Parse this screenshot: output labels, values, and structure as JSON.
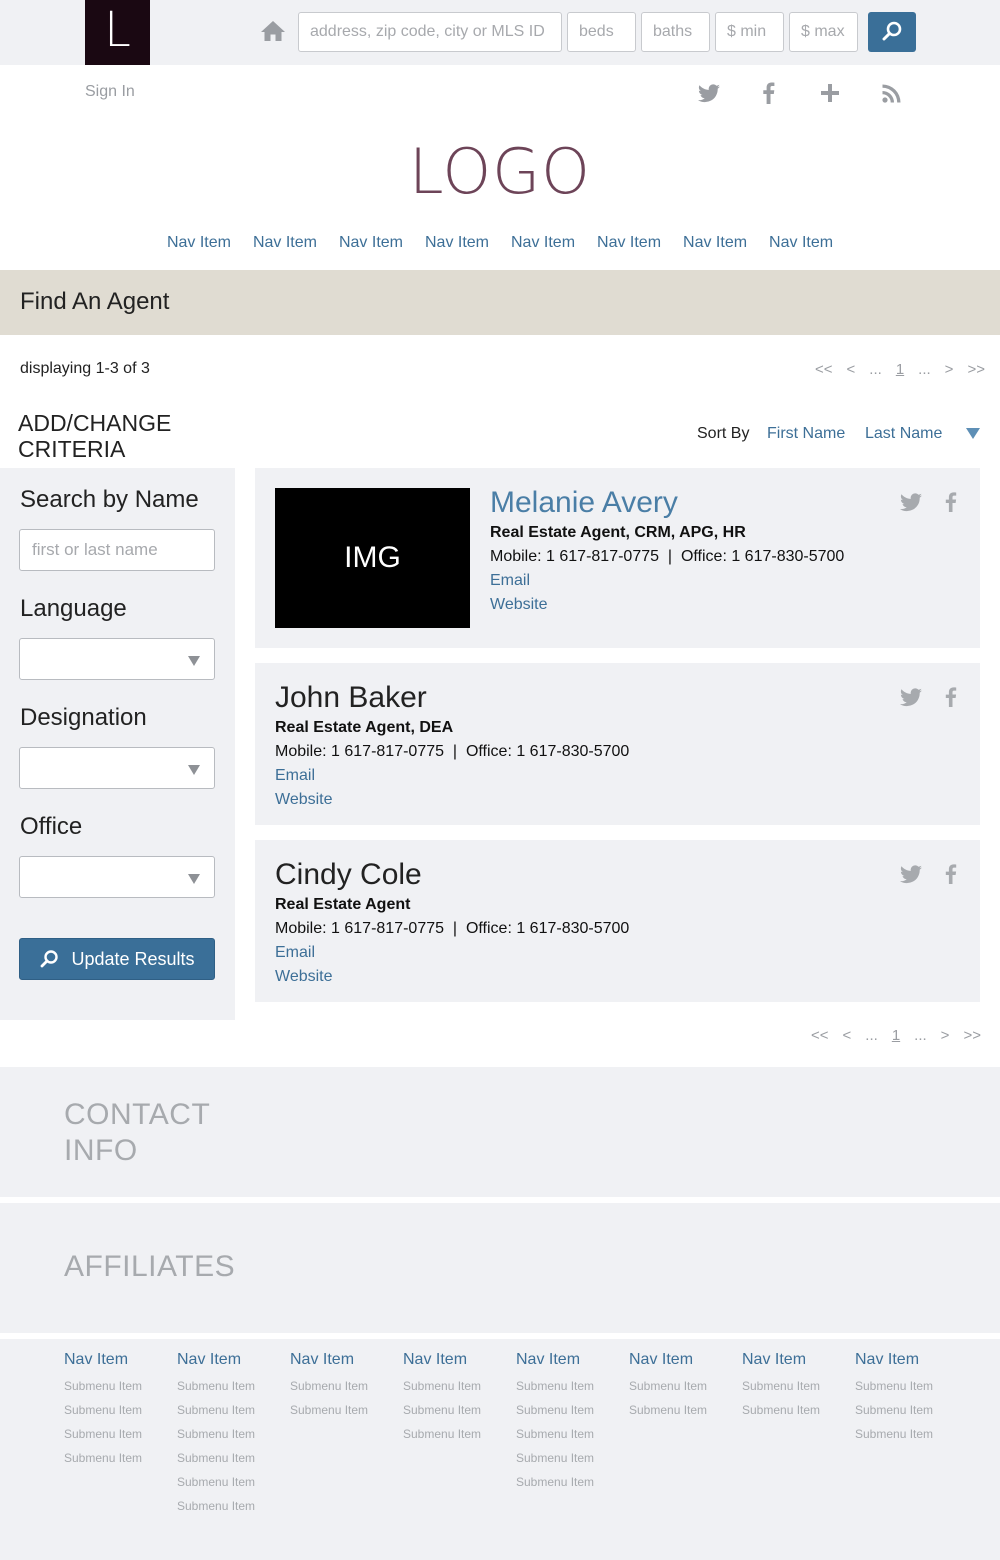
{
  "brand_mark": "L",
  "search": {
    "address_placeholder": "address, zip code, city or MLS ID",
    "beds_placeholder": "beds",
    "baths_placeholder": "baths",
    "min_placeholder": "$ min",
    "max_placeholder": "$ max"
  },
  "header": {
    "sign_in": "Sign In",
    "logo": "LOGO",
    "nav": [
      "Nav Item",
      "Nav Item",
      "Nav Item",
      "Nav Item",
      "Nav Item",
      "Nav Item",
      "Nav Item",
      "Nav Item"
    ]
  },
  "page": {
    "title": "Find An Agent",
    "displaying": "displaying 1-3 of 3",
    "criteria_title": "ADD/CHANGE CRITERIA",
    "sort_by_label": "Sort By",
    "sort_first": "First Name",
    "sort_last": "Last Name"
  },
  "pager": {
    "first": "<<",
    "prev": "<",
    "ellipsis_left": "...",
    "current": "1",
    "ellipsis_right": "...",
    "next": ">",
    "last": ">>"
  },
  "sidebar": {
    "name_heading": "Search by Name",
    "name_placeholder": "first or last name",
    "language_heading": "Language",
    "language_value": "",
    "designation_heading": "Designation",
    "designation_value": "",
    "office_heading": "Office",
    "office_value": "",
    "update_button": "Update Results"
  },
  "agents": [
    {
      "image_label": "IMG",
      "name": "Melanie Avery",
      "title": "Real Estate Agent, CRM, APG, HR",
      "phones": "Mobile: 1 617-817-0775  |  Office: 1 617-830-5700",
      "email": "Email",
      "website": "Website"
    },
    {
      "name": "John Baker",
      "title": "Real Estate Agent, DEA",
      "phones": "Mobile: 1 617-817-0775  |  Office: 1 617-830-5700",
      "email": "Email",
      "website": "Website"
    },
    {
      "name": "Cindy Cole",
      "title": "Real Estate Agent",
      "phones": "Mobile: 1 617-817-0775  |  Office: 1 617-830-5700",
      "email": "Email",
      "website": "Website"
    }
  ],
  "footer": {
    "contact_title": "CONTACT INFO",
    "affiliates_title": "AFFILIATES",
    "columns": [
      {
        "heading": "Nav Item",
        "items": [
          "Submenu Item",
          "Submenu Item",
          "Submenu Item",
          "Submenu Item"
        ]
      },
      {
        "heading": "Nav Item",
        "items": [
          "Submenu Item",
          "Submenu Item",
          "Submenu Item",
          "Submenu Item",
          "Submenu Item",
          "Submenu Item"
        ]
      },
      {
        "heading": "Nav Item",
        "items": [
          "Submenu Item",
          "Submenu Item"
        ]
      },
      {
        "heading": "Nav Item",
        "items": [
          "Submenu Item",
          "Submenu Item",
          "Submenu Item"
        ]
      },
      {
        "heading": "Nav Item",
        "items": [
          "Submenu Item",
          "Submenu Item",
          "Submenu Item",
          "Submenu Item",
          "Submenu Item"
        ]
      },
      {
        "heading": "Nav Item",
        "items": [
          "Submenu Item",
          "Submenu Item"
        ]
      },
      {
        "heading": "Nav Item",
        "items": [
          "Submenu Item",
          "Submenu Item"
        ]
      },
      {
        "heading": "Nav Item",
        "items": [
          "Submenu Item",
          "Submenu Item",
          "Submenu Item"
        ]
      }
    ]
  },
  "icons": {
    "home": "home-icon",
    "search": "search-icon",
    "twitter": "twitter-icon",
    "facebook": "facebook-icon",
    "google_plus": "plus-icon",
    "rss": "rss-icon"
  },
  "colors": {
    "accent": "#3a6f98",
    "link": "#3d6f97",
    "title_band": "#e0dcd2",
    "panel": "#f0f1f4",
    "brand_dark": "#1a0812",
    "logo": "#6d4458"
  }
}
